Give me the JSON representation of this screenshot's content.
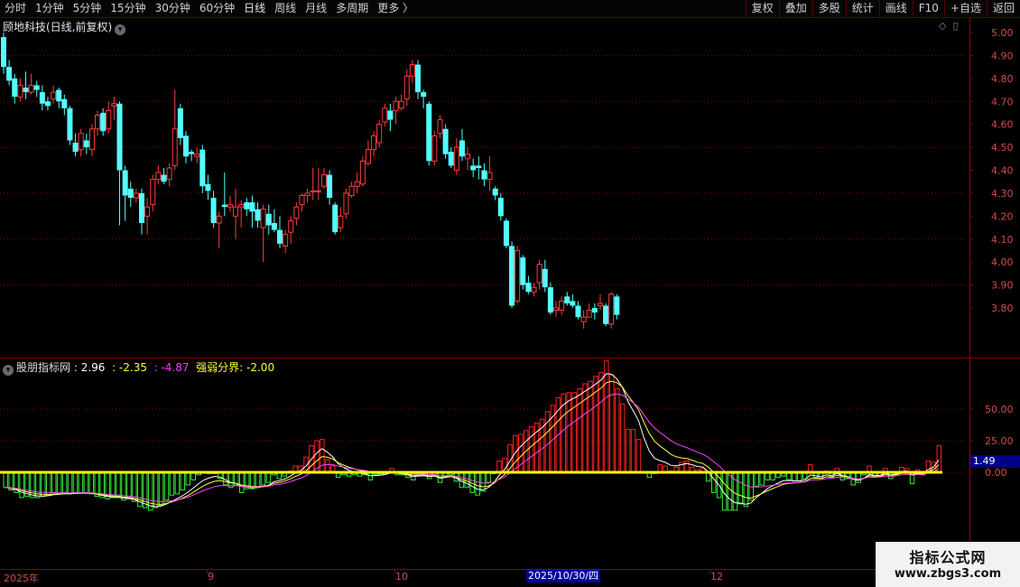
{
  "toolbar": {
    "periods": [
      "分时",
      "1分钟",
      "5分钟",
      "15分钟",
      "30分钟",
      "60分钟",
      "日线",
      "周线",
      "月线",
      "多周期",
      "更多 〉"
    ],
    "active_period": "日线",
    "actions": [
      "复权",
      "叠加",
      "多股",
      "统计",
      "画线",
      "F10",
      "+自选",
      "返回"
    ]
  },
  "stock": {
    "title": "顾地科技(日线,前复权)"
  },
  "main_axis": {
    "ticks": [
      "5.00",
      "4.90",
      "4.80",
      "4.70",
      "4.60",
      "4.50",
      "4.40",
      "4.30",
      "4.20",
      "4.10",
      "4.00",
      "3.90",
      "3.80"
    ]
  },
  "indicator": {
    "name": "股朋指标网",
    "value1": ": 2.96",
    "value2": ": -2.35",
    "value3": ": -4.87",
    "label4": "强弱分界",
    "value4": ": -2.00",
    "axis_ticks": [
      "50.00",
      "25.00",
      "0.00"
    ],
    "current_value": "1.49"
  },
  "date_axis": {
    "labels": [
      "2025年",
      "9",
      "10",
      "12"
    ],
    "highlighted_date": "2025/10/30/四"
  },
  "watermark": {
    "line1": "指标公式网",
    "line2": "www.zbgs3.com"
  },
  "colors": {
    "up": "#ff3c3c",
    "down": "#54ffff",
    "grid": "#8b0000",
    "divider_line": "#ffff00",
    "hist_up": "#ff2020",
    "hist_down": "#33ee33"
  },
  "chart_data": [
    {
      "type": "candlestick",
      "ylim": [
        3.72,
        5.03
      ],
      "candles": [
        [
          4.98,
          4.85,
          5.0,
          4.82
        ],
        [
          4.85,
          4.79,
          4.88,
          4.77
        ],
        [
          4.8,
          4.72,
          4.82,
          4.69
        ],
        [
          4.72,
          4.77,
          4.8,
          4.7
        ],
        [
          4.76,
          4.74,
          4.83,
          4.71
        ],
        [
          4.74,
          4.77,
          4.82,
          4.73
        ],
        [
          4.77,
          4.75,
          4.79,
          4.72
        ],
        [
          4.74,
          4.69,
          4.77,
          4.66
        ],
        [
          4.7,
          4.68,
          4.72,
          4.66
        ],
        [
          4.71,
          4.74,
          4.77,
          4.69
        ],
        [
          4.75,
          4.7,
          4.76,
          4.67
        ],
        [
          4.71,
          4.67,
          4.73,
          4.64
        ],
        [
          4.67,
          4.53,
          4.68,
          4.51
        ],
        [
          4.52,
          4.48,
          4.56,
          4.46
        ],
        [
          4.49,
          4.56,
          4.58,
          4.46
        ],
        [
          4.53,
          4.5,
          4.56,
          4.47
        ],
        [
          4.49,
          4.58,
          4.6,
          4.46
        ],
        [
          4.58,
          4.64,
          4.66,
          4.55
        ],
        [
          4.65,
          4.57,
          4.67,
          4.55
        ],
        [
          4.58,
          4.66,
          4.7,
          4.56
        ],
        [
          4.68,
          4.69,
          4.72,
          4.62
        ],
        [
          4.69,
          4.4,
          4.7,
          4.16
        ],
        [
          4.4,
          4.29,
          4.42,
          4.18
        ],
        [
          4.32,
          4.28,
          4.35,
          4.24
        ],
        [
          4.28,
          4.3,
          4.32,
          4.26
        ],
        [
          4.3,
          4.17,
          4.32,
          4.12
        ],
        [
          4.2,
          4.24,
          4.28,
          4.12
        ],
        [
          4.25,
          4.36,
          4.38,
          4.22
        ],
        [
          4.36,
          4.39,
          4.42,
          4.34
        ],
        [
          4.38,
          4.35,
          4.41,
          4.34
        ],
        [
          4.36,
          4.41,
          4.43,
          4.33
        ],
        [
          4.42,
          4.58,
          4.75,
          4.4
        ],
        [
          4.67,
          4.54,
          4.69,
          4.51
        ],
        [
          4.55,
          4.46,
          4.57,
          4.43
        ],
        [
          4.48,
          4.47,
          4.49,
          4.44
        ],
        [
          4.46,
          4.47,
          4.5,
          4.43
        ],
        [
          4.49,
          4.33,
          4.51,
          4.3
        ],
        [
          4.34,
          4.31,
          4.38,
          4.27
        ],
        [
          4.28,
          4.17,
          4.31,
          4.15
        ],
        [
          4.17,
          4.2,
          4.22,
          4.06
        ],
        [
          4.25,
          4.24,
          4.39,
          4.2
        ],
        [
          4.24,
          4.25,
          4.29,
          4.22
        ],
        [
          4.2,
          4.24,
          4.32,
          4.1
        ],
        [
          4.24,
          4.25,
          4.27,
          4.15
        ],
        [
          4.26,
          4.23,
          4.28,
          4.2
        ],
        [
          4.26,
          4.22,
          4.29,
          4.15
        ],
        [
          4.23,
          4.18,
          4.26,
          4.15
        ],
        [
          4.15,
          4.23,
          4.25,
          4.0
        ],
        [
          4.21,
          4.16,
          4.25,
          4.12
        ],
        [
          4.17,
          4.14,
          4.23,
          4.13
        ],
        [
          4.14,
          4.08,
          4.2,
          4.06
        ],
        [
          4.07,
          4.12,
          4.14,
          4.04
        ],
        [
          4.13,
          4.18,
          4.2,
          4.08
        ],
        [
          4.19,
          4.24,
          4.26,
          4.16
        ],
        [
          4.25,
          4.29,
          4.3,
          4.22
        ],
        [
          4.29,
          4.3,
          4.32,
          4.26
        ],
        [
          4.31,
          4.31,
          4.41,
          4.27
        ],
        [
          4.31,
          4.31,
          4.41,
          4.27
        ],
        [
          4.33,
          4.38,
          4.41,
          4.32
        ],
        [
          4.38,
          4.28,
          4.4,
          4.25
        ],
        [
          4.25,
          4.13,
          4.26,
          4.12
        ],
        [
          4.15,
          4.2,
          4.24,
          4.13
        ],
        [
          4.21,
          4.3,
          4.32,
          4.19
        ],
        [
          4.29,
          4.33,
          4.35,
          4.28
        ],
        [
          4.33,
          4.35,
          4.39,
          4.3
        ],
        [
          4.34,
          4.44,
          4.46,
          4.33
        ],
        [
          4.43,
          4.49,
          4.53,
          4.42
        ],
        [
          4.49,
          4.55,
          4.57,
          4.46
        ],
        [
          4.52,
          4.6,
          4.62,
          4.5
        ],
        [
          4.61,
          4.67,
          4.69,
          4.59
        ],
        [
          4.66,
          4.62,
          4.69,
          4.57
        ],
        [
          4.66,
          4.7,
          4.72,
          4.6
        ],
        [
          4.67,
          4.7,
          4.73,
          4.66
        ],
        [
          4.71,
          4.81,
          4.84,
          4.68
        ],
        [
          4.81,
          4.86,
          4.88,
          4.78
        ],
        [
          4.86,
          4.74,
          4.88,
          4.71
        ],
        [
          4.74,
          4.72,
          4.75,
          4.67
        ],
        [
          4.69,
          4.44,
          4.7,
          4.42
        ],
        [
          4.44,
          4.55,
          4.57,
          4.42
        ],
        [
          4.56,
          4.62,
          4.64,
          4.54
        ],
        [
          4.58,
          4.47,
          4.6,
          4.45
        ],
        [
          4.48,
          4.42,
          4.5,
          4.41
        ],
        [
          4.4,
          4.5,
          4.54,
          4.38
        ],
        [
          4.53,
          4.46,
          4.58,
          4.44
        ],
        [
          4.45,
          4.47,
          4.5,
          4.4
        ],
        [
          4.42,
          4.4,
          4.45,
          4.37
        ],
        [
          4.42,
          4.41,
          4.46,
          4.36
        ],
        [
          4.4,
          4.36,
          4.43,
          4.33
        ],
        [
          4.36,
          4.39,
          4.46,
          4.31
        ],
        [
          4.32,
          4.29,
          4.33,
          4.27
        ],
        [
          4.28,
          4.2,
          4.3,
          4.18
        ],
        [
          4.18,
          4.07,
          4.19,
          4.06
        ],
        [
          4.07,
          3.81,
          4.09,
          3.8
        ],
        [
          3.83,
          4.05,
          4.07,
          3.82
        ],
        [
          4.02,
          3.9,
          4.03,
          3.88
        ],
        [
          3.91,
          3.87,
          3.94,
          3.86
        ],
        [
          3.87,
          3.89,
          3.91,
          3.85
        ],
        [
          3.91,
          3.99,
          4.01,
          3.88
        ],
        [
          3.97,
          3.89,
          4.01,
          3.87
        ],
        [
          3.89,
          3.78,
          3.91,
          3.77
        ],
        [
          3.79,
          3.8,
          3.83,
          3.76
        ],
        [
          3.79,
          3.83,
          3.85,
          3.77
        ],
        [
          3.85,
          3.82,
          3.87,
          3.81
        ],
        [
          3.83,
          3.81,
          3.86,
          3.8
        ],
        [
          3.81,
          3.76,
          3.83,
          3.75
        ],
        [
          3.74,
          3.76,
          3.79,
          3.71
        ],
        [
          3.76,
          3.79,
          3.82,
          3.76
        ],
        [
          3.8,
          3.78,
          3.82,
          3.75
        ],
        [
          3.81,
          3.82,
          3.86,
          3.79
        ],
        [
          3.81,
          3.73,
          3.82,
          3.72
        ],
        [
          3.73,
          3.86,
          3.87,
          3.71
        ],
        [
          3.85,
          3.77,
          3.86,
          3.75
        ]
      ]
    },
    {
      "type": "bar",
      "ylim": [
        -30,
        80
      ],
      "hist": [
        -12,
        -14,
        -16,
        -20,
        -19,
        -20,
        -20,
        -19,
        -18,
        -16,
        -17,
        -16,
        -17,
        -16,
        -16,
        -16,
        -17,
        -19,
        -20,
        -21,
        -20,
        -20,
        -22,
        -21,
        -23,
        -27,
        -28,
        -30,
        -28,
        -26,
        -22,
        -18,
        -17,
        -14,
        -10,
        -6,
        -2,
        0,
        -1,
        -1,
        -5,
        -10,
        -12,
        -10,
        -16,
        -13,
        -13,
        -12,
        -10,
        -8,
        -2,
        -5,
        -3,
        1,
        5,
        5,
        12,
        21,
        25,
        26,
        10,
        5,
        -4,
        -2,
        -3,
        -2,
        -3,
        -2,
        -6,
        -2,
        -2,
        0,
        3,
        -2,
        -2,
        -4,
        -6,
        -2,
        -2,
        -5,
        -2,
        -8,
        -3,
        -2,
        -7,
        -12,
        -12,
        -16,
        -18,
        -15,
        -8,
        -1,
        9,
        11,
        22,
        29,
        30,
        33,
        36,
        39,
        42,
        48,
        53,
        59,
        62,
        63,
        63,
        66,
        70,
        72,
        76,
        79,
        88,
        77,
        66,
        54,
        34,
        34,
        26,
        0,
        -4,
        -1,
        6,
        5,
        1,
        4,
        8,
        9,
        4,
        2,
        3,
        -7,
        -16,
        -20,
        -30,
        -30,
        -30,
        -25,
        -27,
        -22,
        -11,
        -10,
        -6,
        -6,
        -4,
        -3,
        -6,
        -7,
        -7,
        -5,
        6,
        -4,
        -5,
        1,
        -4,
        3,
        -6,
        -5,
        -10,
        -8,
        -2,
        5,
        -4,
        -3,
        3,
        -5,
        0,
        4,
        3,
        -9,
        2,
        -2,
        9,
        8,
        21
      ]
    }
  ]
}
